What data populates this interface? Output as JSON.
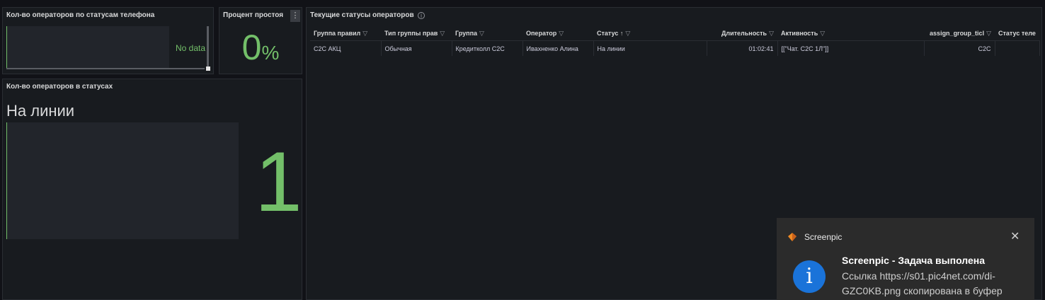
{
  "panels": {
    "phone_status": {
      "title": "Кол-во операторов по статусам телефона",
      "no_data": "No data"
    },
    "idle_percent": {
      "title": "Процент простоя",
      "value": "0",
      "unit": "%",
      "menu_icon": "vertical-dots-icon"
    },
    "operators_in_status": {
      "title": "Кол-во операторов в статусах",
      "status_name": "На линии",
      "value": "1"
    },
    "current_statuses": {
      "title": "Текущие статусы операторов",
      "info_icon": "info-icon",
      "columns": [
        "Группа правил",
        "Тип группы прав",
        "Группа",
        "Оператор",
        "Статус",
        "Длительность",
        "Активность",
        "assign_group_ticl",
        "Статус теле"
      ],
      "sort_indicator": "↑",
      "rows": [
        [
          "C2C АКЦ",
          "Обычная",
          "Кредитколл C2C",
          "Ивахненко Алина",
          "На линии",
          "01:02:41",
          "[[\"Чат. C2C 1Л\"]]",
          "C2C",
          ""
        ]
      ]
    }
  },
  "notification": {
    "app_name": "Screenpic",
    "heading": "Screenpic - Задача выполена",
    "body": "Ссылка https://s01.pic4net.com/di-GZC0KB.png скопирована в буфер",
    "close_icon": "close-icon",
    "info_icon": "info-icon",
    "accent": "#1a73d9"
  },
  "colors": {
    "green": "#73bf69",
    "panel_bg": "#181b1f"
  }
}
